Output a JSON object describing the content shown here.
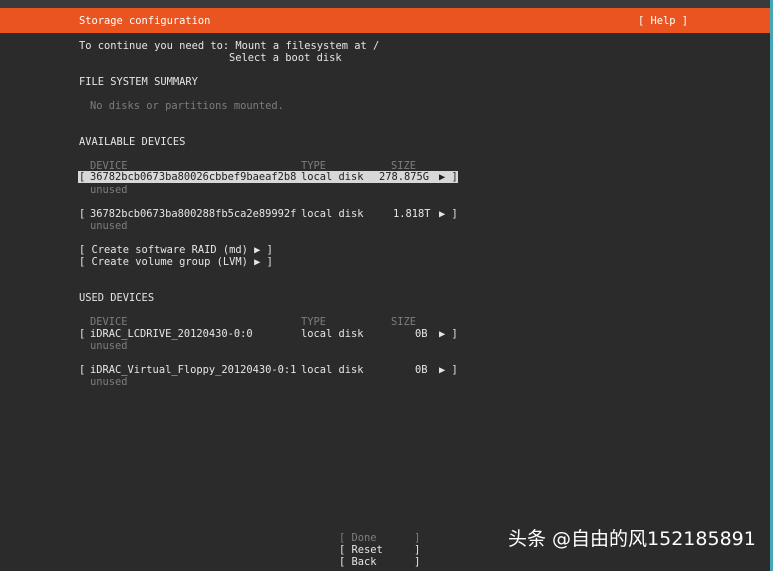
{
  "header": {
    "title": "Storage configuration",
    "help": "[ Help ]"
  },
  "intro": {
    "line1": "To continue you need to: Mount a filesystem at /",
    "line2": "Select a boot disk"
  },
  "fs_summary": {
    "heading": "FILE SYSTEM SUMMARY",
    "empty": "No disks or partitions mounted."
  },
  "available": {
    "heading": "AVAILABLE DEVICES",
    "col_device": "DEVICE",
    "col_type": "TYPE",
    "col_size": "SIZE",
    "devices": [
      {
        "open": "[",
        "name": "36782bcb0673ba80026cbbef9baeaf2b8",
        "type": "local disk",
        "size": "278.875G",
        "arrow": "▶ ]",
        "status": "unused",
        "selected": true
      },
      {
        "open": "[",
        "name": "36782bcb0673ba800288fb5ca2e89992f",
        "type": "local disk",
        "size": "1.818T",
        "arrow": "▶ ]",
        "status": "unused",
        "selected": false
      }
    ],
    "actions": [
      "[ Create software RAID (md) ▶ ]",
      "[ Create volume group (LVM) ▶ ]"
    ]
  },
  "used": {
    "heading": "USED DEVICES",
    "col_device": "DEVICE",
    "col_type": "TYPE",
    "col_size": "SIZE",
    "devices": [
      {
        "open": "[",
        "name": "iDRAC_LCDRIVE_20120430-0:0",
        "type": "local disk",
        "size": "0B",
        "arrow": "▶ ]",
        "status": "unused"
      },
      {
        "open": "[",
        "name": "iDRAC_Virtual_Floppy_20120430-0:1",
        "type": "local disk",
        "size": "0B",
        "arrow": "▶ ]",
        "status": "unused"
      }
    ]
  },
  "footer": {
    "done": "[ Done      ]",
    "reset": "[ Reset     ]",
    "back": "[ Back      ]"
  },
  "watermark": "头条 @自由的风152185891",
  "colors": {
    "header": "#e95420",
    "background": "#2b2b2b",
    "selected_bg": "#d8d8d8",
    "dim_text": "#7d7d7d"
  }
}
